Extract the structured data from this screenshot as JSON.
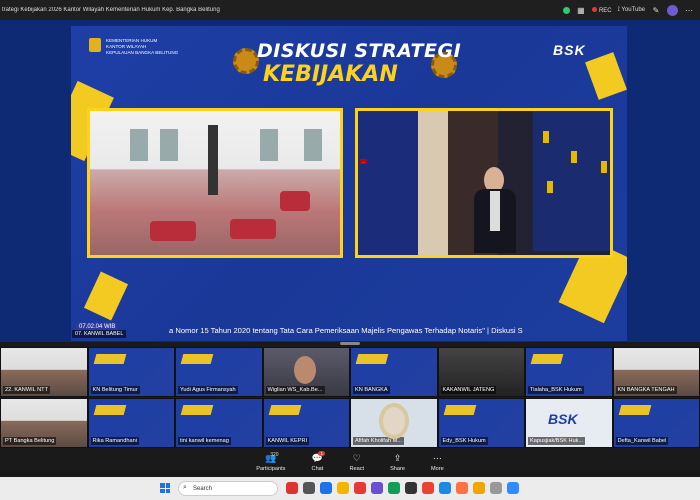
{
  "window": {
    "title": "trategi Kebijakan 2026 Kantor Wilayah Kementerian Hukum Kep. Bangka Belitung",
    "rec_label": "REC",
    "youtube_label": "YouTube"
  },
  "slide": {
    "org_lines": [
      "KEMENTERIAN HUKUM",
      "KANTOR WILAYAH",
      "KEPULAUAN BANGKA BELITUNG"
    ],
    "heading_line1": "DISKUSI STRATEGI",
    "heading_line2": "KEBIJAKAN",
    "brand": "BSK",
    "ticker_time": "07.02.04 WIB",
    "ticker_text": "a Nomor 15 Tahun 2020 tentang Tata Cara Pemeriksaan Majelis Pengawas Terhadap Notaris\" | Diskusi S",
    "speaker_name": "07. KANWIL BABEL",
    "nameplate": "..."
  },
  "gallery": [
    {
      "label": "22. KANWIL NTT",
      "kind": "room"
    },
    {
      "label": "KN Belitung Timur",
      "kind": "slide"
    },
    {
      "label": "Yudi Agus Firmansyah",
      "kind": "slide"
    },
    {
      "label": "Wiglian WS_Kab.Be...",
      "kind": "face"
    },
    {
      "label": "KN BANGKA",
      "kind": "slide"
    },
    {
      "label": "KAKANWIL JATENG",
      "kind": "dark"
    },
    {
      "label": "Tialaha_BSK Hukum",
      "kind": "slide"
    },
    {
      "label": "KN BANGKA TENGAH",
      "kind": "room"
    },
    {
      "label": "PT Bangka Belitung",
      "kind": "room"
    },
    {
      "label": "Rika Ramandhani",
      "kind": "slide"
    },
    {
      "label": "tini kanwil kemenag",
      "kind": "slide"
    },
    {
      "label": "KANWIL KEPRI",
      "kind": "slide"
    },
    {
      "label": "Afifah Kholifah M...",
      "kind": "hijab"
    },
    {
      "label": "Edy_BSK Hukum",
      "kind": "slide"
    },
    {
      "label": "Kapusjiak/BSK Huk...",
      "kind": "bsk"
    },
    {
      "label": "Defta_Kanwil Babel",
      "kind": "slide"
    }
  ],
  "controls": {
    "participants_label": "Participants",
    "participants_count": "320",
    "chat_label": "Chat",
    "chat_badge": "1",
    "react_label": "React",
    "share_label": "Share",
    "more_label": "More"
  },
  "taskbar": {
    "search_label": "Search"
  }
}
